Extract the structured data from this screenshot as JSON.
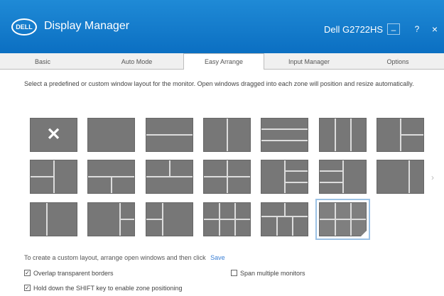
{
  "app": {
    "logo": "DELL",
    "title": "Display Manager",
    "monitor": "Dell G2722HS"
  },
  "window_controls": {
    "minimize": "–",
    "help": "?",
    "close": "×"
  },
  "tabs": [
    {
      "label": "Basic"
    },
    {
      "label": "Auto Mode"
    },
    {
      "label": "Easy Arrange"
    },
    {
      "label": "Input Manager"
    },
    {
      "label": "Options"
    }
  ],
  "description": "Select a predefined or custom window layout for the monitor. Open windows dragged into each zone will position and resize automatically.",
  "custom_layout": {
    "text": "To create a custom layout, arrange open windows and then click",
    "save_label": "Save"
  },
  "options": [
    {
      "label": "Overlap transparent borders",
      "checked": true
    },
    {
      "label": "Span multiple monitors",
      "checked": false
    },
    {
      "label": "Hold down the SHIFT key to enable zone positioning",
      "checked": true
    }
  ],
  "icons": {
    "none_layout": "x-mark-icon",
    "scroll": "chevron-right-icon"
  }
}
